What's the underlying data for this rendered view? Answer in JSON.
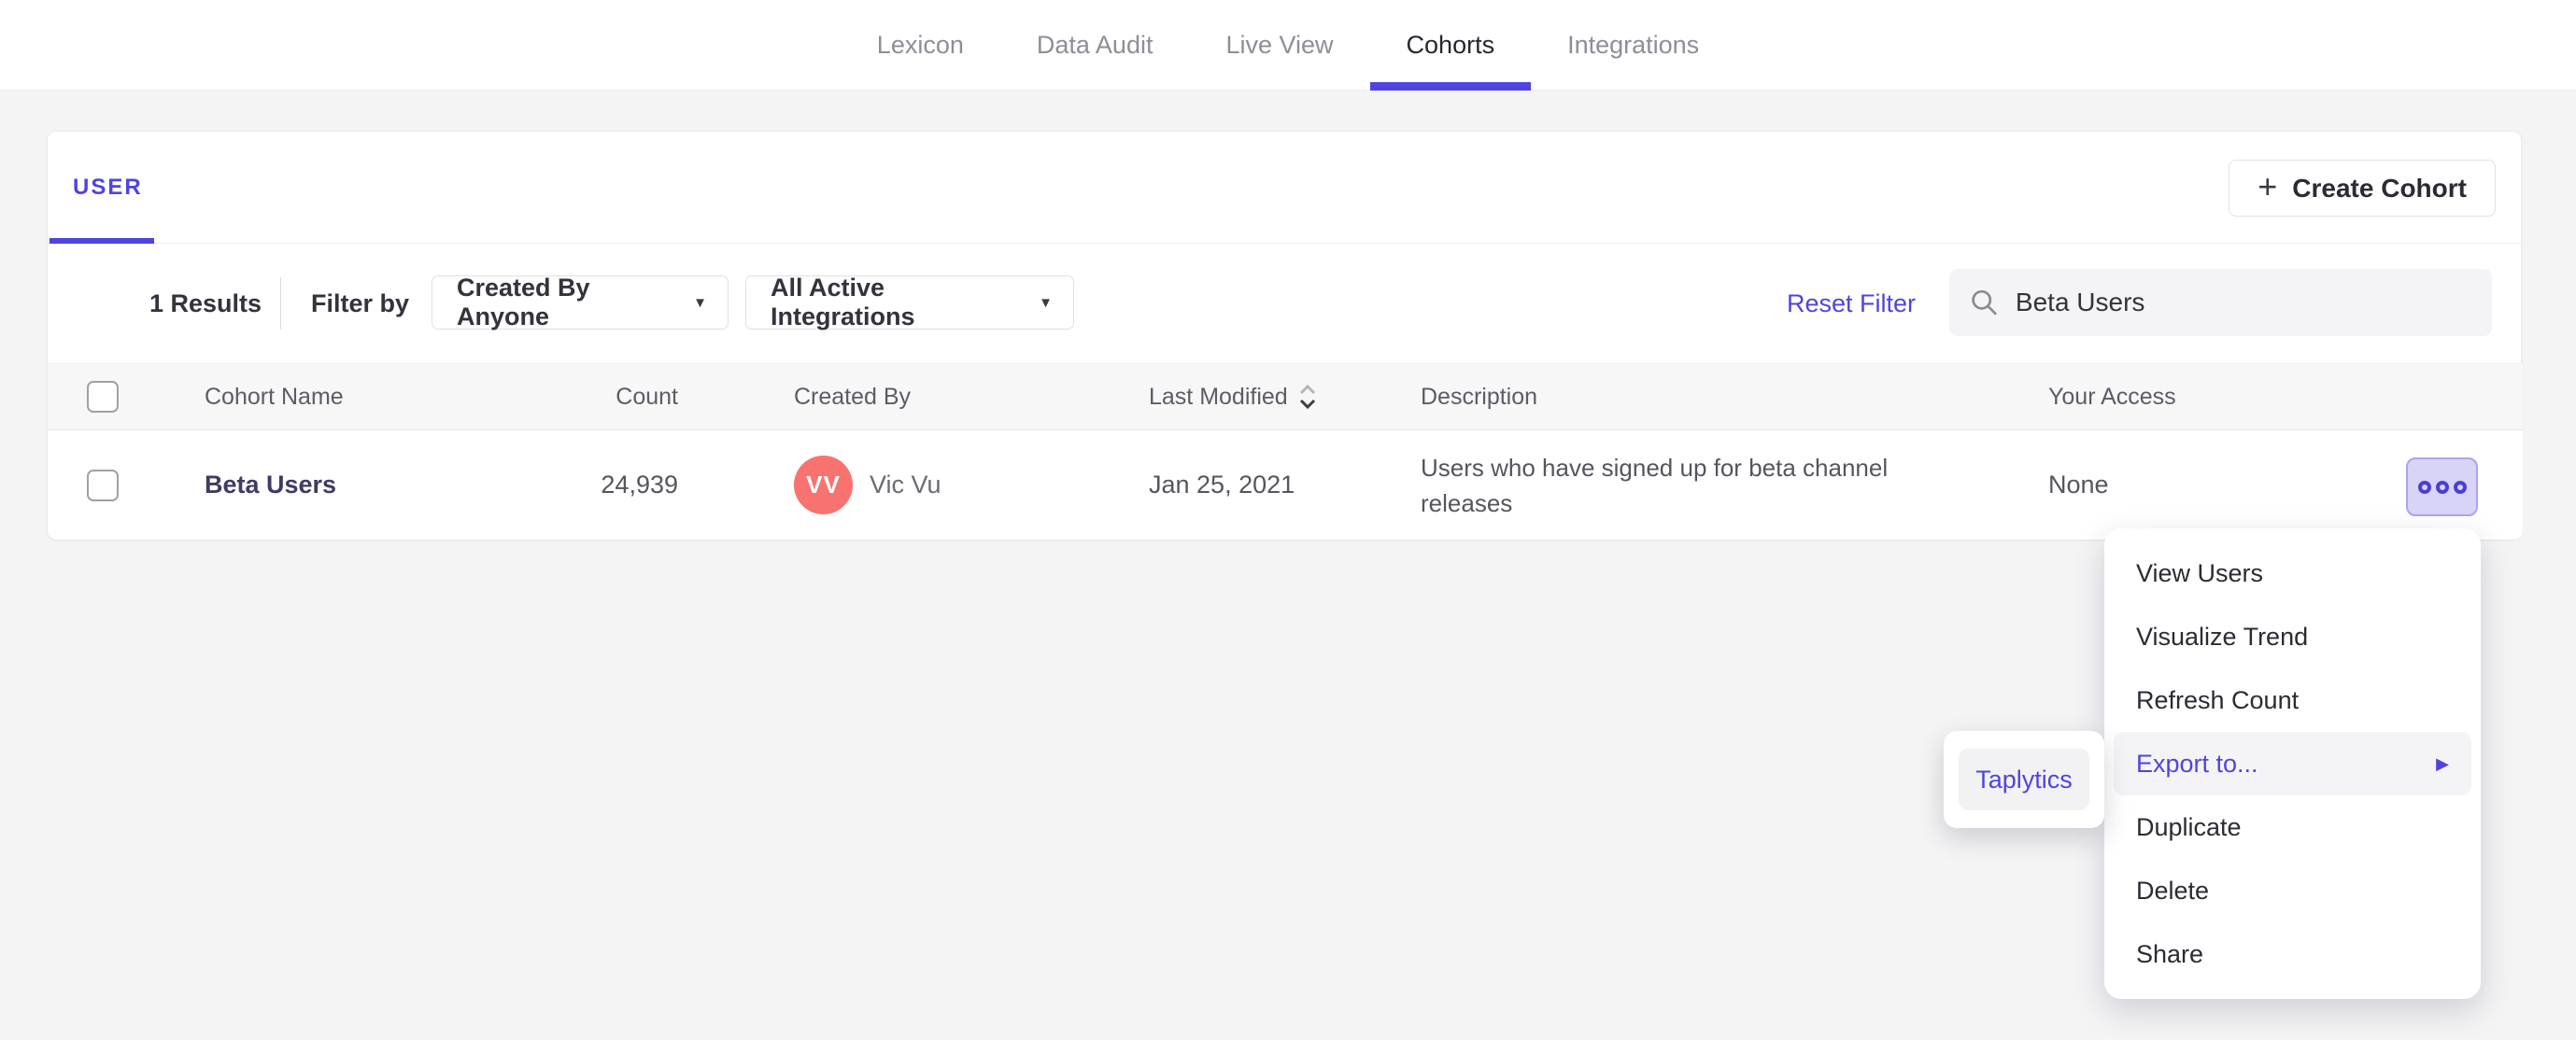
{
  "colors": {
    "accent": "#4f44e0",
    "accent_dark": "#4a3fd4",
    "link": "#3f3b63",
    "avatar_bg": "#f87370",
    "text_dark": "#2a2a33",
    "text_header": "#5c5c66",
    "nav_inactive": "#8e8e97",
    "bg_page": "#f4f4f5",
    "input_bg": "#f4f4f6",
    "ellipsis_bg": "#d8d4f6",
    "ellipsis_border": "#aca5ec",
    "highlight_row": "#f4f4f6"
  },
  "nav": {
    "active_tab": "Cohorts",
    "tabs": [
      {
        "label": "Lexicon"
      },
      {
        "label": "Data Audit"
      },
      {
        "label": "Live View"
      },
      {
        "label": "Cohorts"
      },
      {
        "label": "Integrations"
      }
    ]
  },
  "card": {
    "tab_label": "USER",
    "create_button": {
      "plus_icon": "+",
      "label": "Create Cohort"
    },
    "filter_bar": {
      "results": "1 Results",
      "filter_by_label": "Filter by",
      "created_by_dropdown": "Created By Anyone",
      "integrations_dropdown": "All Active Integrations",
      "caret_icon": "▼",
      "reset_link": "Reset Filter",
      "search_value": "Beta Users"
    },
    "table": {
      "headers": {
        "cohort_name": "Cohort Name",
        "count": "Count",
        "created_by": "Created By",
        "last_modified": "Last Modified",
        "description": "Description",
        "your_access": "Your Access"
      },
      "row": {
        "name": "Beta Users",
        "count": "24,939",
        "avatar_initials": "VV",
        "created_by": "Vic Vu",
        "last_modified": "Jan 25, 2021",
        "description": "Users who have signed up for beta channel releases",
        "your_access": "None"
      }
    }
  },
  "context_menu": {
    "submenu_arrow_icon": "▶",
    "items": [
      {
        "label": "View Users",
        "active": false
      },
      {
        "label": "Visualize Trend",
        "active": false
      },
      {
        "label": "Refresh Count",
        "active": false
      },
      {
        "label": "Export to...",
        "active": true,
        "has_submenu": true
      },
      {
        "label": "Duplicate",
        "active": false
      },
      {
        "label": "Delete",
        "active": false
      },
      {
        "label": "Share",
        "active": false
      }
    ]
  },
  "submenu": {
    "items": [
      {
        "label": "Taplytics"
      }
    ]
  }
}
